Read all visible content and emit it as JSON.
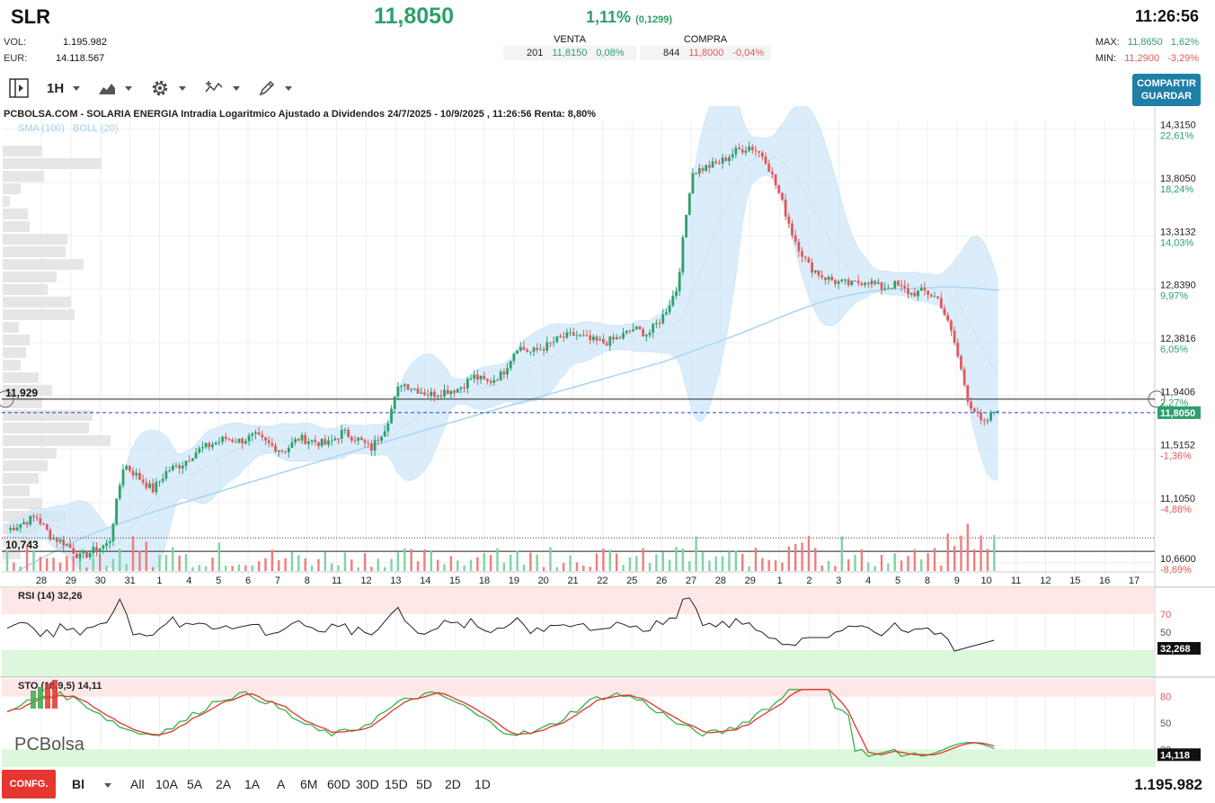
{
  "header": {
    "ticker": "SLR",
    "price": "11,8050",
    "change_pct": "1,11%",
    "change_abs": "(0,1299)",
    "time": "11:26:56",
    "vol_label": "VOL:",
    "vol_value": "1.195.982",
    "eur_label": "EUR:",
    "eur_value": "14.118.567",
    "sell": {
      "title": "VENTA",
      "qty": "201",
      "price": "11,8150",
      "pct": "0,08%"
    },
    "buy": {
      "title": "COMPRA",
      "qty": "844",
      "price": "11,8000",
      "pct": "-0,04%"
    },
    "max": {
      "label": "MAX:",
      "value": "11,8650",
      "pct": "1,62%"
    },
    "min": {
      "label": "MIN:",
      "value": "11,2900",
      "pct": "-3,29%"
    }
  },
  "toolbar": {
    "interval": "1H",
    "share_label_1": "COMPARTIR",
    "share_label_2": "GUARDAR"
  },
  "chart_title": "PCBOLSA.COM - SOLARIA ENERGIA Intradia Logaritmico Ajustado a Dividendos 24/7/2025 - 10/9/2025 , 11:26:56 Renta: 8,80%",
  "legend": {
    "sma": "SMA (100)",
    "boll": "BOLL (20)"
  },
  "colors": {
    "up": "#2e9f6b",
    "down": "#e05a5a",
    "boll": "#cfe8fa",
    "sma": "#a9d8f3",
    "accent": "#1f7fa8"
  },
  "price_axis": [
    {
      "price": "14,3150",
      "pct": "22,61%"
    },
    {
      "price": "13,8050",
      "pct": "18,24%"
    },
    {
      "price": "13,3132",
      "pct": "14,03%"
    },
    {
      "price": "12,8390",
      "pct": "9,97%"
    },
    {
      "price": "12,3816",
      "pct": "6,05%"
    },
    {
      "price": "11,9406",
      "pct": "2,27%"
    },
    {
      "price": "11,5152",
      "pct": "-1,36%"
    },
    {
      "price": "11,1050",
      "pct": "-4,88%"
    },
    {
      "price": "10,6600",
      "pct": "-8,69%"
    }
  ],
  "current_price_tag": "11,8050",
  "level_high": "11,929",
  "level_low": "10,743",
  "x_labels": [
    "28",
    "29",
    "30",
    "31",
    "1",
    "4",
    "5",
    "6",
    "7",
    "8",
    "11",
    "12",
    "13",
    "14",
    "15",
    "18",
    "19",
    "20",
    "21",
    "22",
    "25",
    "26",
    "27",
    "28",
    "29",
    "1",
    "2",
    "3",
    "4",
    "5",
    "8",
    "9",
    "10",
    "11",
    "12",
    "15",
    "16",
    "17"
  ],
  "rsi": {
    "label": "RSI (14)",
    "value": "32,26",
    "tag": "32,268",
    "levels": [
      "70",
      "50",
      "30"
    ]
  },
  "sto": {
    "label": "STO (18,9,5)",
    "value": "14,11",
    "tag": "14,118",
    "levels": [
      "80",
      "50",
      "20"
    ]
  },
  "watermark": "PCBolsa",
  "bottom": {
    "config": "CONFG.",
    "chart_type": "Bl",
    "periods": [
      "All",
      "10A",
      "5A",
      "2A",
      "1A",
      "A",
      "6M",
      "60D",
      "30D",
      "15D",
      "5D",
      "2D",
      "1D"
    ],
    "volume": "1.195.982"
  },
  "chart_data": {
    "type": "candlestick",
    "price_range": [
      10.6,
      14.4
    ],
    "close_series": [
      10.9,
      10.95,
      11.0,
      10.85,
      10.8,
      10.7,
      10.75,
      10.8,
      11.4,
      11.3,
      11.2,
      11.35,
      11.4,
      11.5,
      11.55,
      11.6,
      11.58,
      11.62,
      11.55,
      11.5,
      11.6,
      11.58,
      11.55,
      11.65,
      11.6,
      11.52,
      11.7,
      12.05,
      12.0,
      11.95,
      11.98,
      12.0,
      12.1,
      12.05,
      12.12,
      12.35,
      12.3,
      12.35,
      12.42,
      12.45,
      12.4,
      12.38,
      12.42,
      12.5,
      12.45,
      12.6,
      12.85,
      13.9,
      13.95,
      14.0,
      14.1,
      14.15,
      14.05,
      13.7,
      13.3,
      13.05,
      12.95,
      12.9,
      12.88,
      12.92,
      12.85,
      12.88,
      12.8,
      12.82,
      12.75,
      12.4,
      11.9,
      11.7,
      11.85
    ],
    "sma100": [
      10.6,
      10.7,
      10.8,
      10.88,
      10.95,
      11.02,
      11.08,
      11.14,
      11.2,
      11.26,
      11.32,
      11.38,
      11.44,
      11.5,
      11.56,
      11.62,
      11.68,
      11.74,
      11.8,
      11.86,
      11.92,
      11.98,
      12.04,
      12.1,
      12.16,
      12.22,
      12.3,
      12.38,
      12.46,
      12.55,
      12.64,
      12.72,
      12.78,
      12.82,
      12.84,
      12.85,
      12.86,
      12.85,
      12.83
    ],
    "series": [
      {
        "name": "SMA (100)"
      },
      {
        "name": "BOLL (20)"
      }
    ]
  }
}
